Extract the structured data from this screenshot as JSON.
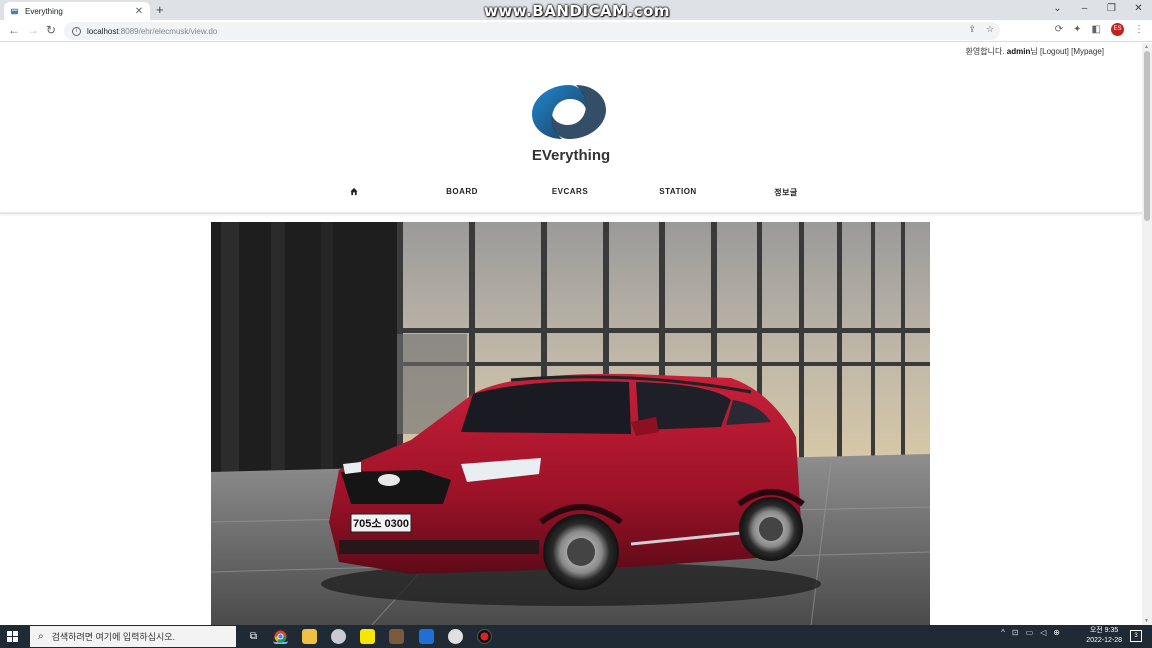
{
  "browser": {
    "tab_title": "Everything",
    "url_host": "localhost",
    "url_rest": ":8089/ehr/elecmusk/view.do",
    "watermark": "www.BANDICAM.com",
    "profile_initials": "ES"
  },
  "site": {
    "greeting": "환영합니다.",
    "username": "admin",
    "username_suffix": "님",
    "logout_label": "[Logout]",
    "mypage_label": "[Mypage]",
    "brand_name": "EVerything",
    "nav": [
      {
        "label": ""
      },
      {
        "label": "BOARD"
      },
      {
        "label": "EVCARS"
      },
      {
        "label": "STATION"
      },
      {
        "label": "정보글"
      }
    ],
    "hero_plate": "705소 0300",
    "colors": {
      "logo_blue": "#1a73b8",
      "logo_dark": "#1f3b57",
      "car_red": "#a8122a"
    }
  },
  "taskbar": {
    "search_placeholder": "검색하려면 여기에 입력하십시오.",
    "time": "오전 9:35",
    "date": "2022-12-28"
  }
}
